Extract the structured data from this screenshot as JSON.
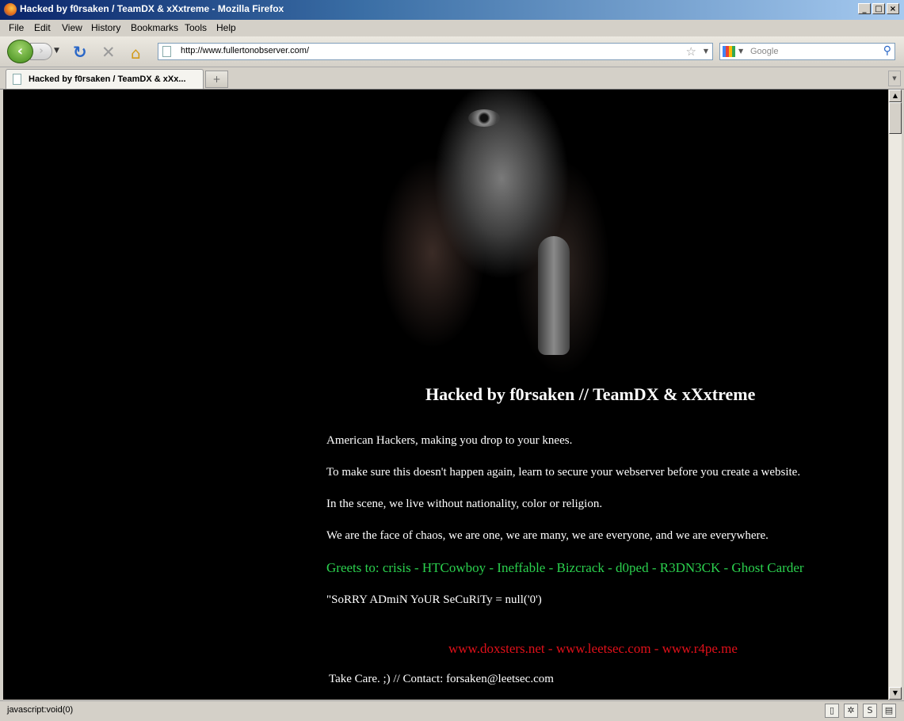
{
  "window": {
    "title": "Hacked by f0rsaken / TeamDX & xXxtreme - Mozilla Firefox",
    "controls": [
      "_",
      "□",
      "×"
    ]
  },
  "menu": [
    "File",
    "Edit",
    "View",
    "History",
    "Bookmarks",
    "Tools",
    "Help"
  ],
  "toolbar": {
    "url": "http://www.fullertonobserver.com/",
    "search_placeholder": "Google"
  },
  "tabs": [
    {
      "label": "Hacked by f0rsaken / TeamDX & xXx...",
      "active": true
    }
  ],
  "page": {
    "headline": "Hacked by f0rsaken // TeamDX & xXxtreme",
    "paragraphs": [
      "American Hackers, making you drop to your knees.",
      "To make sure this doesn't happen again, learn to secure your webserver before you create a website.",
      "In the scene, we live without nationality, color or religion.",
      "We are the face of chaos, we are one, we are many, we are everyone, and we are everywhere."
    ],
    "greets": "Greets to: crisis - HTCowboy - Ineffable - Bizcrack - d0ped - R3DN3CK - Ghost Carder",
    "sorry": "\"SoRRY ADmiN YoUR SeCuRiTy = null('0')",
    "links": "www.doxsters.net - www.leetsec.com - www.r4pe.me",
    "contact": "Take Care. ;) // Contact: forsaken@leetsec.com"
  },
  "status": {
    "text": "javascript:void(0)"
  },
  "colors": {
    "page_bg": "#000000",
    "text": "#ffffff",
    "greets": "#2bd14e",
    "links": "#e0101a"
  },
  "icons": [
    "firefox-logo-icon",
    "back-arrow-icon",
    "forward-arrow-icon",
    "reload-icon",
    "stop-icon",
    "home-icon",
    "page-icon",
    "bookmark-star-icon",
    "google-engine-icon",
    "magnifier-icon",
    "new-tab-icon"
  ]
}
